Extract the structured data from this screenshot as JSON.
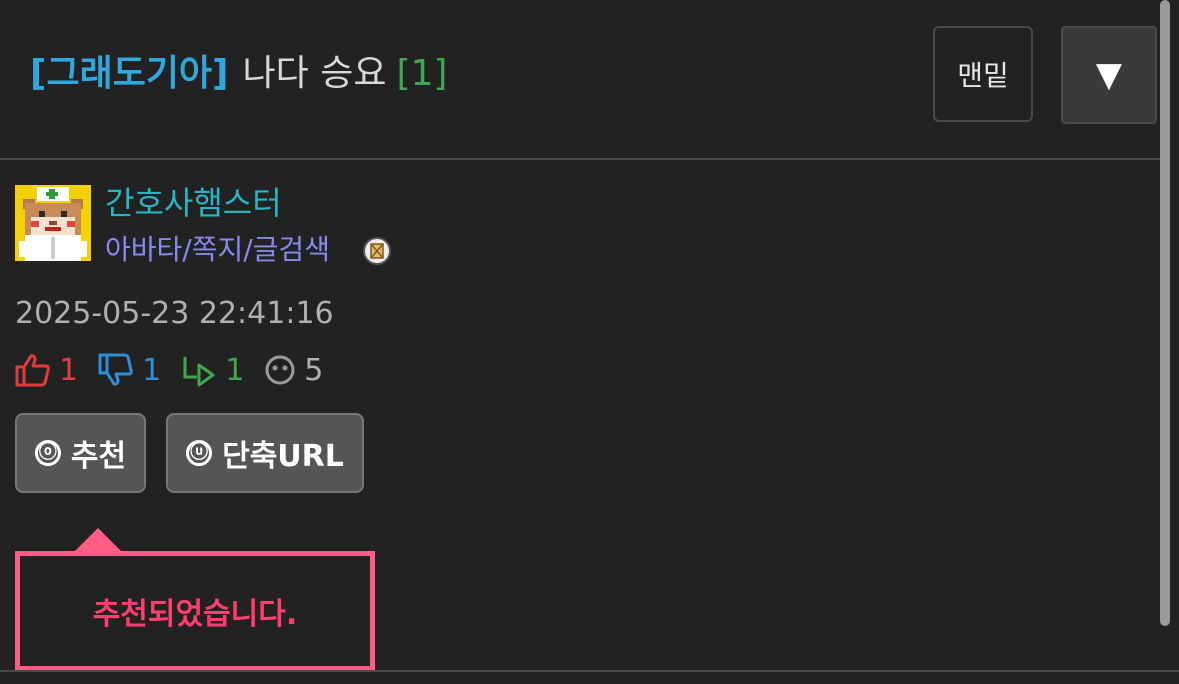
{
  "post": {
    "category": "[그래도기아]",
    "title": "나다 승요",
    "comment_count": "[1]"
  },
  "header": {
    "bottom_button": "맨밑",
    "menu_button": "▼"
  },
  "author": {
    "name": "간호사햄스터",
    "links": "아바타/쪽지/글검색",
    "datetime": "2025-05-23 22:41:16"
  },
  "stats": {
    "upvotes": "1",
    "downvotes": "1",
    "replies": "1",
    "views": "5"
  },
  "actions": {
    "recommend_icon": "ⓞ",
    "recommend_label": "추천",
    "shorturl_icon": "ⓤ",
    "shorturl_label": "단축URL"
  },
  "notice": {
    "message": "추천되었습니다."
  },
  "colors": {
    "background": "#222222",
    "category": "#30a8de",
    "comment_count": "#3ea84a",
    "author_name": "#26b6c4",
    "author_links": "#8c86f0",
    "upvote": "#e43b3b",
    "downvote": "#2e8fd9",
    "reply": "#3ea84a",
    "notice_border": "#ff5c86",
    "notice_text": "#ff3d6e"
  },
  "icons": {
    "avatar": "nurse-hamster-avatar",
    "memo": "memo-icon",
    "upvote": "thumbs-up-icon",
    "downvote": "thumbs-down-icon",
    "reply": "reply-arrow-icon",
    "view": "face-icon"
  }
}
